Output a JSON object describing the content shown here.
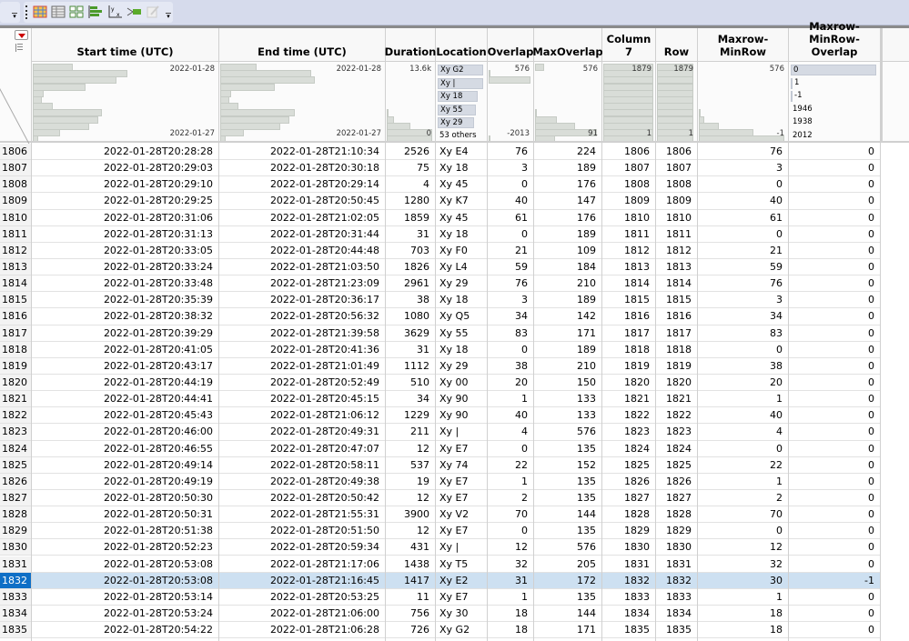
{
  "toolbar": {
    "icons": [
      "data-table-icon",
      "columns-viewer-icon",
      "tile-icon",
      "bar-chart-icon",
      "yx-fit-icon",
      "graph-builder-icon",
      "edit-icon"
    ]
  },
  "columns": [
    {
      "id": "start",
      "label": "Start time (UTC)",
      "top": "2022-01-28",
      "bottom": "2022-01-27"
    },
    {
      "id": "end",
      "label": "End time (UTC)",
      "top": "2022-01-28",
      "bottom": "2022-01-27"
    },
    {
      "id": "duration",
      "label": "Duration",
      "top": "13.6k",
      "bottom": "0"
    },
    {
      "id": "location",
      "label": "Location",
      "cats": [
        "Xy G2",
        "Xy |",
        "Xy 18",
        "Xy 55",
        "Xy 29",
        "53 others"
      ]
    },
    {
      "id": "overlap",
      "label": "Overlap",
      "top": "576",
      "bottom": "-2013"
    },
    {
      "id": "maxoverlap",
      "label": "MaxOverlap",
      "top": "576",
      "bottom": "91"
    },
    {
      "id": "col7",
      "label": "Column 7",
      "top": "1879",
      "bottom": "1"
    },
    {
      "id": "row",
      "label": "Row",
      "top": "1879",
      "bottom": "1"
    },
    {
      "id": "mrm",
      "label": "Maxrow-MinRow",
      "top": "576",
      "bottom": "-1"
    },
    {
      "id": "mrmo",
      "label": "Maxrow-MinRow-Overlap",
      "cats": [
        "0",
        "1",
        "-1",
        "1946",
        "1938",
        "2012"
      ]
    }
  ],
  "selected_row": "1832",
  "rows": [
    [
      "1806",
      "2022-01-28T20:28:28",
      "2022-01-28T21:10:34",
      "2526",
      "Xy E4",
      "76",
      "224",
      "1806",
      "1806",
      "76",
      "0"
    ],
    [
      "1807",
      "2022-01-28T20:29:03",
      "2022-01-28T20:30:18",
      "75",
      "Xy 18",
      "3",
      "189",
      "1807",
      "1807",
      "3",
      "0"
    ],
    [
      "1808",
      "2022-01-28T20:29:10",
      "2022-01-28T20:29:14",
      "4",
      "Xy 45",
      "0",
      "176",
      "1808",
      "1808",
      "0",
      "0"
    ],
    [
      "1809",
      "2022-01-28T20:29:25",
      "2022-01-28T20:50:45",
      "1280",
      "Xy K7",
      "40",
      "147",
      "1809",
      "1809",
      "40",
      "0"
    ],
    [
      "1810",
      "2022-01-28T20:31:06",
      "2022-01-28T21:02:05",
      "1859",
      "Xy 45",
      "61",
      "176",
      "1810",
      "1810",
      "61",
      "0"
    ],
    [
      "1811",
      "2022-01-28T20:31:13",
      "2022-01-28T20:31:44",
      "31",
      "Xy 18",
      "0",
      "189",
      "1811",
      "1811",
      "0",
      "0"
    ],
    [
      "1812",
      "2022-01-28T20:33:05",
      "2022-01-28T20:44:48",
      "703",
      "Xy F0",
      "21",
      "109",
      "1812",
      "1812",
      "21",
      "0"
    ],
    [
      "1813",
      "2022-01-28T20:33:24",
      "2022-01-28T21:03:50",
      "1826",
      "Xy L4",
      "59",
      "184",
      "1813",
      "1813",
      "59",
      "0"
    ],
    [
      "1814",
      "2022-01-28T20:33:48",
      "2022-01-28T21:23:09",
      "2961",
      "Xy 29",
      "76",
      "210",
      "1814",
      "1814",
      "76",
      "0"
    ],
    [
      "1815",
      "2022-01-28T20:35:39",
      "2022-01-28T20:36:17",
      "38",
      "Xy 18",
      "3",
      "189",
      "1815",
      "1815",
      "3",
      "0"
    ],
    [
      "1816",
      "2022-01-28T20:38:32",
      "2022-01-28T20:56:32",
      "1080",
      "Xy Q5",
      "34",
      "142",
      "1816",
      "1816",
      "34",
      "0"
    ],
    [
      "1817",
      "2022-01-28T20:39:29",
      "2022-01-28T21:39:58",
      "3629",
      "Xy 55",
      "83",
      "171",
      "1817",
      "1817",
      "83",
      "0"
    ],
    [
      "1818",
      "2022-01-28T20:41:05",
      "2022-01-28T20:41:36",
      "31",
      "Xy 18",
      "0",
      "189",
      "1818",
      "1818",
      "0",
      "0"
    ],
    [
      "1819",
      "2022-01-28T20:43:17",
      "2022-01-28T21:01:49",
      "1112",
      "Xy 29",
      "38",
      "210",
      "1819",
      "1819",
      "38",
      "0"
    ],
    [
      "1820",
      "2022-01-28T20:44:19",
      "2022-01-28T20:52:49",
      "510",
      "Xy 00",
      "20",
      "150",
      "1820",
      "1820",
      "20",
      "0"
    ],
    [
      "1821",
      "2022-01-28T20:44:41",
      "2022-01-28T20:45:15",
      "34",
      "Xy 90",
      "1",
      "133",
      "1821",
      "1821",
      "1",
      "0"
    ],
    [
      "1822",
      "2022-01-28T20:45:43",
      "2022-01-28T21:06:12",
      "1229",
      "Xy 90",
      "40",
      "133",
      "1822",
      "1822",
      "40",
      "0"
    ],
    [
      "1823",
      "2022-01-28T20:46:00",
      "2022-01-28T20:49:31",
      "211",
      "Xy |",
      "4",
      "576",
      "1823",
      "1823",
      "4",
      "0"
    ],
    [
      "1824",
      "2022-01-28T20:46:55",
      "2022-01-28T20:47:07",
      "12",
      "Xy E7",
      "0",
      "135",
      "1824",
      "1824",
      "0",
      "0"
    ],
    [
      "1825",
      "2022-01-28T20:49:14",
      "2022-01-28T20:58:11",
      "537",
      "Xy 74",
      "22",
      "152",
      "1825",
      "1825",
      "22",
      "0"
    ],
    [
      "1826",
      "2022-01-28T20:49:19",
      "2022-01-28T20:49:38",
      "19",
      "Xy E7",
      "1",
      "135",
      "1826",
      "1826",
      "1",
      "0"
    ],
    [
      "1827",
      "2022-01-28T20:50:30",
      "2022-01-28T20:50:42",
      "12",
      "Xy E7",
      "2",
      "135",
      "1827",
      "1827",
      "2",
      "0"
    ],
    [
      "1828",
      "2022-01-28T20:50:31",
      "2022-01-28T21:55:31",
      "3900",
      "Xy V2",
      "70",
      "144",
      "1828",
      "1828",
      "70",
      "0"
    ],
    [
      "1829",
      "2022-01-28T20:51:38",
      "2022-01-28T20:51:50",
      "12",
      "Xy E7",
      "0",
      "135",
      "1829",
      "1829",
      "0",
      "0"
    ],
    [
      "1830",
      "2022-01-28T20:52:23",
      "2022-01-28T20:59:34",
      "431",
      "Xy |",
      "12",
      "576",
      "1830",
      "1830",
      "12",
      "0"
    ],
    [
      "1831",
      "2022-01-28T20:53:08",
      "2022-01-28T21:17:06",
      "1438",
      "Xy T5",
      "32",
      "205",
      "1831",
      "1831",
      "32",
      "0"
    ],
    [
      "1832",
      "2022-01-28T20:53:08",
      "2022-01-28T21:16:45",
      "1417",
      "Xy E2",
      "31",
      "172",
      "1832",
      "1832",
      "30",
      "-1"
    ],
    [
      "1833",
      "2022-01-28T20:53:14",
      "2022-01-28T20:53:25",
      "11",
      "Xy E7",
      "1",
      "135",
      "1833",
      "1833",
      "1",
      "0"
    ],
    [
      "1834",
      "2022-01-28T20:53:24",
      "2022-01-28T21:06:00",
      "756",
      "Xy 30",
      "18",
      "144",
      "1834",
      "1834",
      "18",
      "0"
    ],
    [
      "1835",
      "2022-01-28T20:54:22",
      "2022-01-28T21:06:28",
      "726",
      "Xy G2",
      "18",
      "171",
      "1835",
      "1835",
      "18",
      "0"
    ]
  ]
}
